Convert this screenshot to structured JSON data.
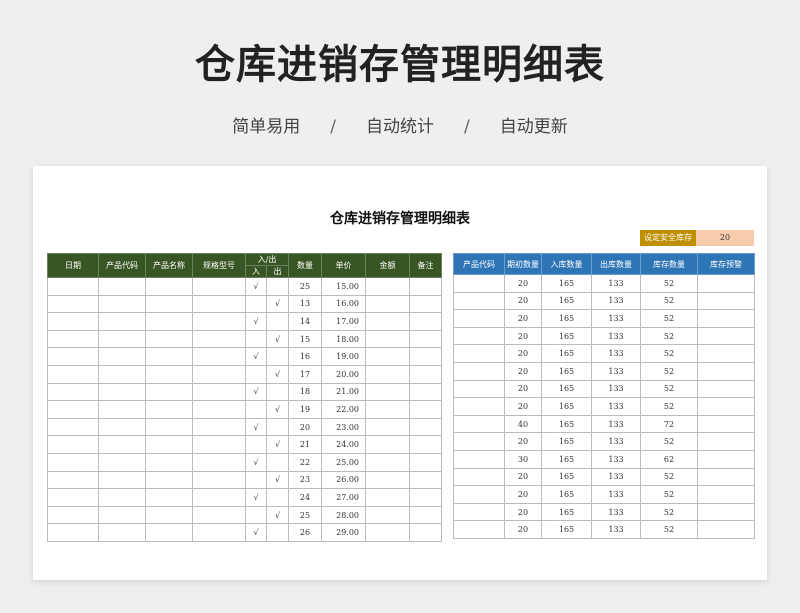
{
  "header": {
    "title": "仓库进销存管理明细表",
    "tags": [
      "简单易用",
      "自动统计",
      "自动更新"
    ],
    "separator": "/"
  },
  "sheet": {
    "title": "仓库进销存管理明细表",
    "safety_stock": {
      "label": "设定安全库存",
      "value": "20"
    },
    "left_table": {
      "headers": [
        "日期",
        "产品代码",
        "产品名称",
        "规格型号",
        "入/出",
        "数量",
        "单价",
        "金额",
        "备注"
      ],
      "in_out_sub": [
        "入",
        "出"
      ],
      "rows": [
        {
          "in": "√",
          "out": "",
          "qty": "25",
          "price": "15.00"
        },
        {
          "in": "",
          "out": "√",
          "qty": "13",
          "price": "16.00"
        },
        {
          "in": "√",
          "out": "",
          "qty": "14",
          "price": "17.00"
        },
        {
          "in": "",
          "out": "√",
          "qty": "15",
          "price": "18.00"
        },
        {
          "in": "√",
          "out": "",
          "qty": "16",
          "price": "19.00"
        },
        {
          "in": "",
          "out": "√",
          "qty": "17",
          "price": "20.00"
        },
        {
          "in": "√",
          "out": "",
          "qty": "18",
          "price": "21.00"
        },
        {
          "in": "",
          "out": "√",
          "qty": "19",
          "price": "22.00"
        },
        {
          "in": "√",
          "out": "",
          "qty": "20",
          "price": "23.00"
        },
        {
          "in": "",
          "out": "√",
          "qty": "21",
          "price": "24.00"
        },
        {
          "in": "√",
          "out": "",
          "qty": "22",
          "price": "25.00"
        },
        {
          "in": "",
          "out": "√",
          "qty": "23",
          "price": "26.00"
        },
        {
          "in": "√",
          "out": "",
          "qty": "24",
          "price": "27.00"
        },
        {
          "in": "",
          "out": "√",
          "qty": "25",
          "price": "28.00"
        },
        {
          "in": "√",
          "out": "",
          "qty": "26",
          "price": "29.00"
        }
      ]
    },
    "right_table": {
      "headers": [
        "产品代码",
        "期初数量",
        "入库数量",
        "出库数量",
        "库存数量",
        "库存预警"
      ],
      "rows": [
        {
          "opening": "20",
          "inbound": "165",
          "outbound": "133",
          "stock": "52"
        },
        {
          "opening": "20",
          "inbound": "165",
          "outbound": "133",
          "stock": "52"
        },
        {
          "opening": "20",
          "inbound": "165",
          "outbound": "133",
          "stock": "52"
        },
        {
          "opening": "20",
          "inbound": "165",
          "outbound": "133",
          "stock": "52"
        },
        {
          "opening": "20",
          "inbound": "165",
          "outbound": "133",
          "stock": "52"
        },
        {
          "opening": "20",
          "inbound": "165",
          "outbound": "133",
          "stock": "52"
        },
        {
          "opening": "20",
          "inbound": "165",
          "outbound": "133",
          "stock": "52"
        },
        {
          "opening": "20",
          "inbound": "165",
          "outbound": "133",
          "stock": "52"
        },
        {
          "opening": "40",
          "inbound": "165",
          "outbound": "133",
          "stock": "72"
        },
        {
          "opening": "20",
          "inbound": "165",
          "outbound": "133",
          "stock": "52"
        },
        {
          "opening": "30",
          "inbound": "165",
          "outbound": "133",
          "stock": "62"
        },
        {
          "opening": "20",
          "inbound": "165",
          "outbound": "133",
          "stock": "52"
        },
        {
          "opening": "20",
          "inbound": "165",
          "outbound": "133",
          "stock": "52"
        },
        {
          "opening": "20",
          "inbound": "165",
          "outbound": "133",
          "stock": "52"
        },
        {
          "opening": "20",
          "inbound": "165",
          "outbound": "133",
          "stock": "52"
        }
      ]
    }
  }
}
